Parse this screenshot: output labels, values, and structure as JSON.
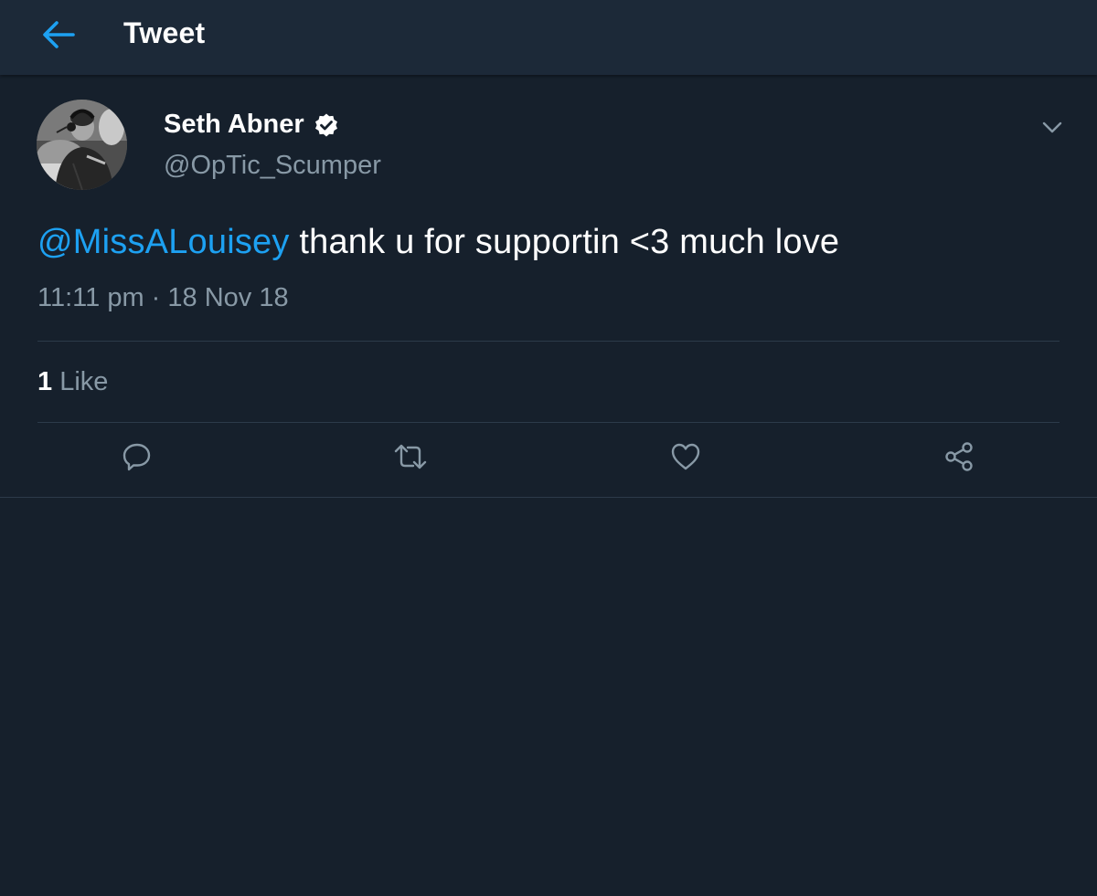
{
  "header": {
    "back_icon": "arrow-left-icon",
    "title": "Tweet"
  },
  "tweet": {
    "author": {
      "display_name": "Seth Abner",
      "verified": true,
      "handle": "@OpTic_Scumper"
    },
    "text": {
      "mention": "@MissALouisey",
      "body": " thank u for supportin <3 much love"
    },
    "timestamp": "11:11 pm · 18 Nov 18",
    "likes": {
      "count": "1",
      "label": " Like"
    },
    "actions": [
      {
        "name": "reply",
        "icon": "reply-icon"
      },
      {
        "name": "retweet",
        "icon": "retweet-icon"
      },
      {
        "name": "like",
        "icon": "heart-icon"
      },
      {
        "name": "share",
        "icon": "share-icon"
      }
    ]
  },
  "colors": {
    "background": "#16202c",
    "header_bg": "#1c2938",
    "accent": "#1da1f2",
    "secondary_text": "#8899a6",
    "divider": "#2c3a4a"
  }
}
